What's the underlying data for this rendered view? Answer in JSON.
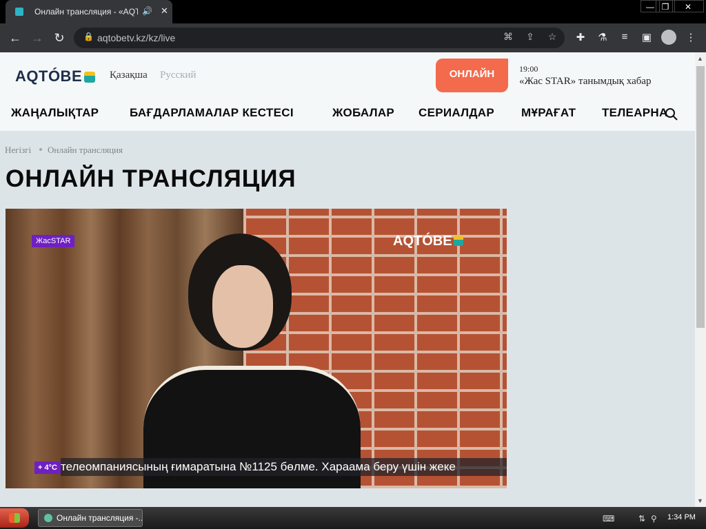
{
  "browser": {
    "tab_title": "Онлайн трансляция - «AQTÓ",
    "url": "aqtobetv.kz/kz/live",
    "controls": {
      "minimize": "—",
      "restore": "❐",
      "close": "✕"
    }
  },
  "site": {
    "logo_text": "AQTÓBE",
    "lang_kz": "Қазақша",
    "lang_ru": "Русский",
    "online_button": "ОНЛАЙН",
    "schedule_time": "19:00",
    "schedule_title": "«Жас STAR» танымдық хабар",
    "menu": [
      "ЖАҢАЛЫҚТАР",
      "БАҒДАРЛАМАЛАР КЕСТЕСІ",
      "ЖОБАЛАР",
      "СЕРИАЛДАР",
      "МҰРАҒАТ",
      "ТЕЛЕАРНА"
    ],
    "breadcrumb_home": "Негізгі",
    "breadcrumb_current": "Онлайн трансляция",
    "page_title": "ОНЛАЙН ТРАНСЛЯЦИЯ"
  },
  "video": {
    "show_badge": "ЖасSTAR",
    "logo_text": "AQTÓBE",
    "temperature": "+ 4°C",
    "ticker": "телеомпаниясының ғимаратына №1125 бөлме. Хараама беру үшін жеке"
  },
  "taskbar": {
    "task_button": "Онлайн трансляция -...",
    "clock": "1:34 PM"
  },
  "colors": {
    "accent": "#f36a4c",
    "brand_navy": "#1e2f4b",
    "badge_purple": "#6f20c2"
  }
}
